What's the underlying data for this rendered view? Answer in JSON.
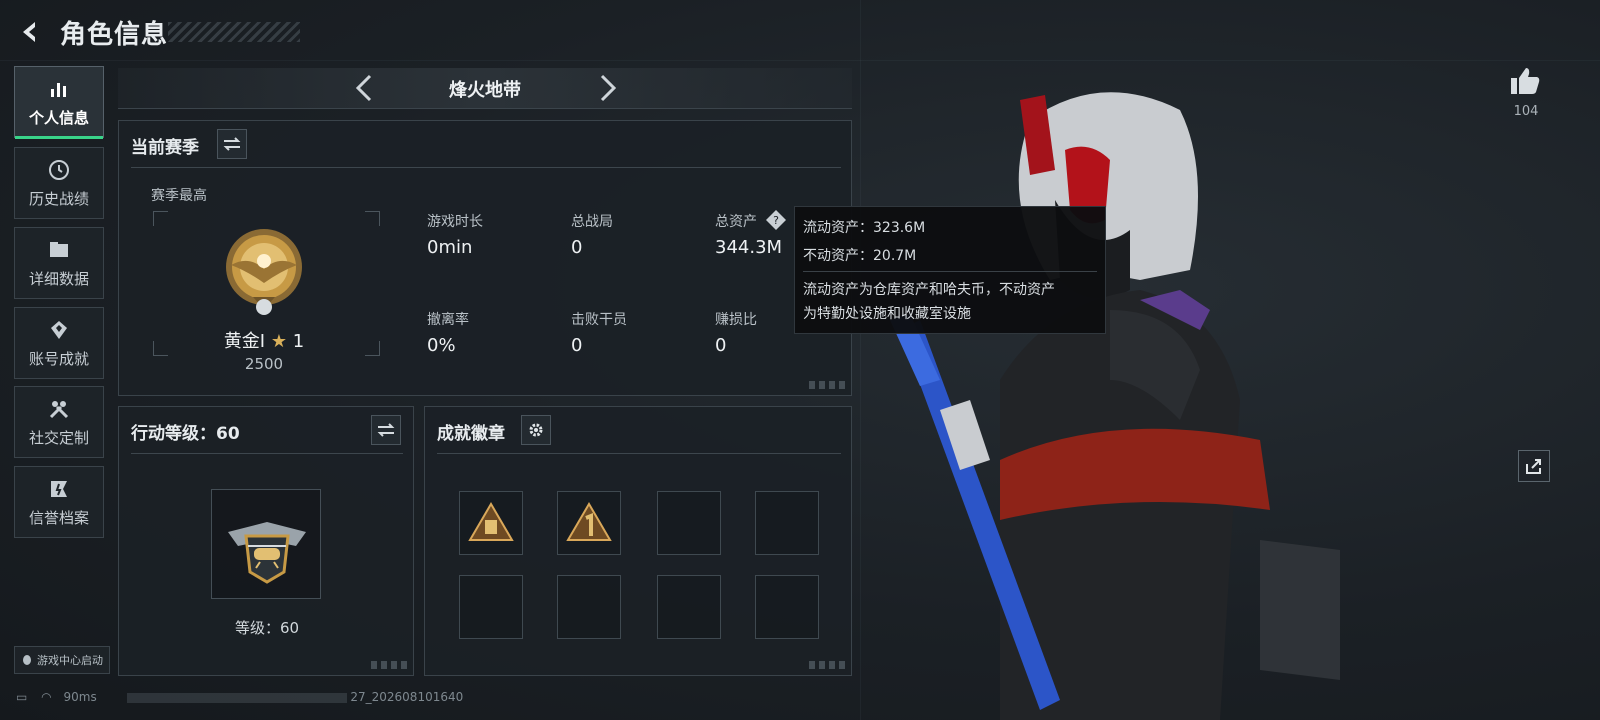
{
  "header": {
    "title": "角色信息"
  },
  "sidebar": {
    "items": [
      {
        "label": "个人信息",
        "icon": "bar-chart-icon",
        "active": true
      },
      {
        "label": "历史战绩",
        "icon": "history-icon"
      },
      {
        "label": "详细数据",
        "icon": "folder-icon"
      },
      {
        "label": "账号成就",
        "icon": "achievement-icon"
      },
      {
        "label": "社交定制",
        "icon": "tools-icon"
      },
      {
        "label": "信誉档案",
        "icon": "credit-icon"
      }
    ],
    "game_center": "游戏中心启动"
  },
  "mode": {
    "name": "烽火地带"
  },
  "season": {
    "title": "当前赛季",
    "best_label": "赛季最高",
    "rank_name": "黄金I",
    "rank_stars": "1",
    "rank_points": "2500",
    "stats": [
      {
        "label": "游戏时长",
        "value": "0min"
      },
      {
        "label": "总战局",
        "value": "0"
      },
      {
        "label": "总资产",
        "value": "344.3M"
      },
      {
        "label": "撤离率",
        "value": "0%"
      },
      {
        "label": "击败干员",
        "value": "0"
      },
      {
        "label": "赚损比",
        "value": "0"
      }
    ]
  },
  "tooltip": {
    "liquid": "流动资产：323.6M",
    "fixed": "不动资产：20.7M",
    "desc1": "流动资产为仓库资产和哈夫币，不动资产",
    "desc2": "为特勤处设施和收藏室设施"
  },
  "action_level": {
    "title": "行动等级：60",
    "level_text": "等级：60"
  },
  "achievements": {
    "title": "成就徽章"
  },
  "social": {
    "like_count": "104"
  },
  "status_bar": {
    "ping": "90ms",
    "build": "27_202608101640"
  },
  "colors": {
    "accent_green": "#39d48a",
    "gold": "#c79a45"
  }
}
